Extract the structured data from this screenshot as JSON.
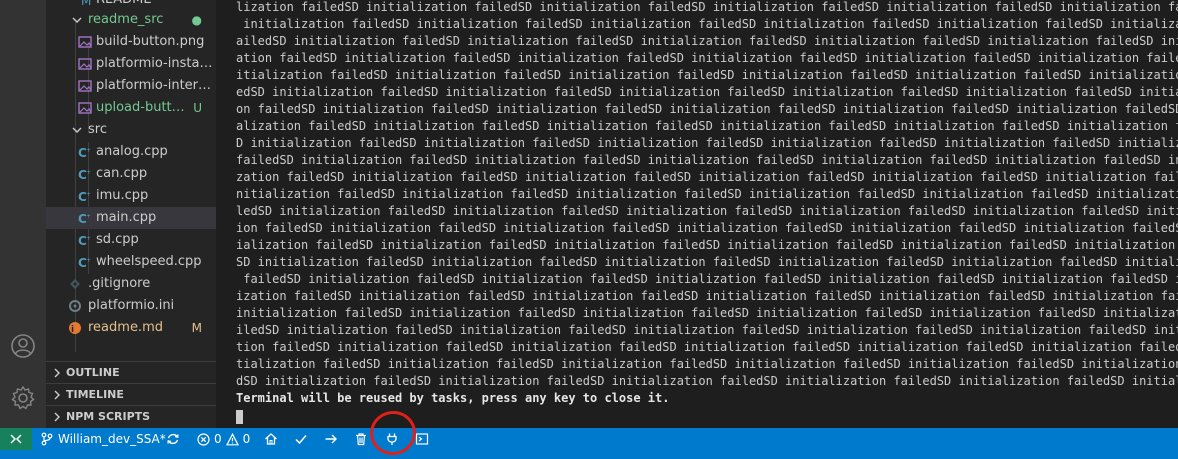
{
  "explorer": {
    "items": [
      {
        "label": "README",
        "badge": "",
        "color": "#cccccc",
        "icon": "markdown-file-icon"
      },
      {
        "label": "readme_src",
        "badge": "●",
        "color": "#73c991",
        "icon": "chevron-down-icon"
      },
      {
        "label": "build-button.png",
        "badge": "",
        "color": "#cccccc",
        "icon": "image-file-icon"
      },
      {
        "label": "platformio-installat...",
        "badge": "",
        "color": "#cccccc",
        "icon": "image-file-icon"
      },
      {
        "label": "platformio-interfac...",
        "badge": "",
        "color": "#cccccc",
        "icon": "image-file-icon"
      },
      {
        "label": "upload-butto...",
        "badge": "U",
        "color": "#73c991",
        "icon": "image-file-icon"
      },
      {
        "label": "src",
        "badge": "",
        "color": "#cccccc",
        "icon": "chevron-down-icon"
      },
      {
        "label": "analog.cpp",
        "badge": "",
        "color": "#cccccc",
        "icon": "cpp-file-icon"
      },
      {
        "label": "can.cpp",
        "badge": "",
        "color": "#cccccc",
        "icon": "cpp-file-icon"
      },
      {
        "label": "imu.cpp",
        "badge": "",
        "color": "#cccccc",
        "icon": "cpp-file-icon"
      },
      {
        "label": "main.cpp",
        "badge": "",
        "color": "#cccccc",
        "icon": "cpp-file-icon"
      },
      {
        "label": "sd.cpp",
        "badge": "",
        "color": "#cccccc",
        "icon": "cpp-file-icon"
      },
      {
        "label": "wheelspeed.cpp",
        "badge": "",
        "color": "#cccccc",
        "icon": "cpp-file-icon"
      },
      {
        "label": ".gitignore",
        "badge": "",
        "color": "#cccccc",
        "icon": "git-icon"
      },
      {
        "label": "platformio.ini",
        "badge": "",
        "color": "#cccccc",
        "icon": "gear-file-icon"
      },
      {
        "label": "readme.md",
        "badge": "M",
        "color": "#e2c08d",
        "icon": "markdown-file-icon"
      }
    ],
    "sections": [
      "OUTLINE",
      "TIMELINE",
      "NPM SCRIPTS"
    ]
  },
  "terminal": {
    "lines": [
      "lization failedSD initialization failedSD initialization failedSD initialization failedSD initialization failedSD initialization failedSD",
      " initialization failedSD initialization failedSD initialization failedSD initialization failedSD initialization failedSD initialization",
      "ailedSD initialization failedSD initialization failedSD initialization failedSD initialization failedSD initialization failedSD initiali",
      "ation failedSD initialization failedSD initialization failedSD initialization failedSD initialization failedSD initialization failedSD i",
      "itialization failedSD initialization failedSD initialization failedSD initialization failedSD initialization failedSD initialization fa",
      "edSD initialization failedSD initialization failedSD initialization failedSD initialization failedSD initialization failedSD initializa",
      "on failedSD initialization failedSD initialization failedSD initialization failedSD initialization failedSD initialization failedSD ini",
      "alization failedSD initialization failedSD initialization failedSD initialization failedSD initialization failedSD initialization faile",
      "D initialization failedSD initialization failedSD initialization failedSD initialization failedSD initialization failedSD initializatio",
      "failedSD initialization failedSD initialization failedSD initialization failedSD initialization failedSD initialization failedSD initia",
      "zation failedSD initialization failedSD initialization failedSD initialization failedSD initialization failedSD initialization failedSD",
      "nitialization failedSD initialization failedSD initialization failedSD initialization failedSD initialization failedSD initialization f",
      "ledSD initialization failedSD initialization failedSD initialization failedSD initialization failedSD initialization failedSD initializ",
      "ion failedSD initialization failedSD initialization failedSD initialization failedSD initialization failedSD initialization failedSD in",
      "ialization failedSD initialization failedSD initialization failedSD initialization failedSD initialization failedSD initialization fail",
      "SD initialization failedSD initialization failedSD initialization failedSD initialization failedSD initialization failedSD initializati",
      " failedSD initialization failedSD initialization failedSD initialization failedSD initialization failedSD initialization failedSD initi",
      "ization failedSD initialization failedSD initialization failedSD initialization failedSD initialization failedSD initialization failedS",
      "initialization failedSD initialization failedSD initialization failedSD initialization failedSD initialization failedSD initialization",
      "iledSD initialization failedSD initialization failedSD initialization failedSD initialization failedSD initialization failedSD initiali",
      "tion failedSD initialization failedSD initialization failedSD initialization failedSD initialization failedSD initialization failedSD i",
      "tialization failedSD initialization failedSD initialization failedSD initialization failedSD initialization failedSD initialization fai",
      "dSD initialization failedSD initialization failedSD initialization failedSD initialization failedSD initialization failedSD initializat"
    ],
    "final_message": "Terminal will be reused by tasks, press any key to close it."
  },
  "statusbar": {
    "branch": "William_dev_SSA*",
    "errors": "0",
    "warnings": "0",
    "accent": "#007acc",
    "remote_color": "#16825d"
  },
  "highlight_color": "#e0201b"
}
